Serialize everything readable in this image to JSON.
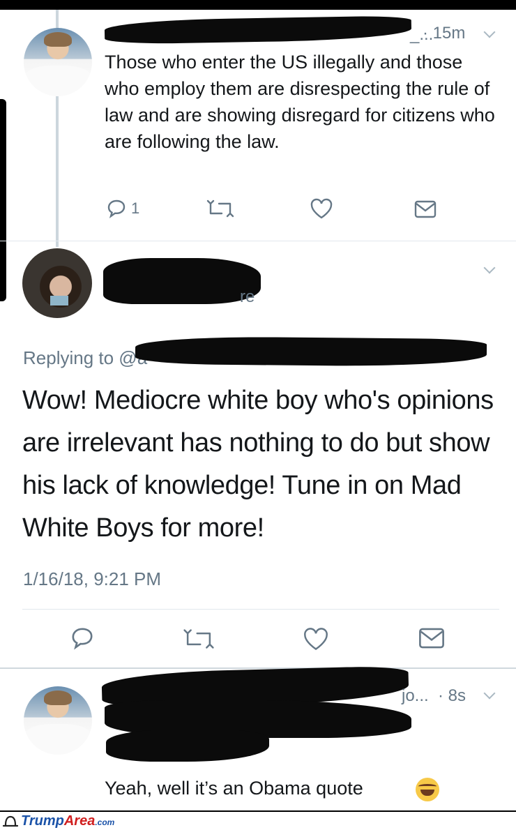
{
  "tweet1": {
    "time": "· 15m",
    "handle_tail": "_...",
    "text": "Those who enter the US illegally and those who employ them are disrespecting the rule of law and are showing disregard for citizens who are following the law.",
    "reply_count": "1"
  },
  "tweet2": {
    "handle_tail": "re",
    "replying_label": "Replying to @a",
    "text": "Wow! Mediocre white boy who's opinions are irrelevant has nothing to do but show his lack of knowledge! Tune in on Mad White Boys for more!",
    "timestamp": "1/16/18, 9:21 PM"
  },
  "tweet3": {
    "handle_tail": "jo...",
    "time": "· 8s",
    "text": "Yeah, well it’s an Obama quote",
    "emoji": "face-with-tears-of-joy"
  },
  "watermark": {
    "brand_main": "Trump",
    "brand_accent": "Area",
    "brand_suffix": ".com"
  },
  "colors": {
    "text": "#14171a",
    "muted": "#657786",
    "icon": "#657786",
    "divider": "#e1e8ed",
    "watermark_blue": "#1a52a8",
    "watermark_red": "#d01f1f"
  }
}
